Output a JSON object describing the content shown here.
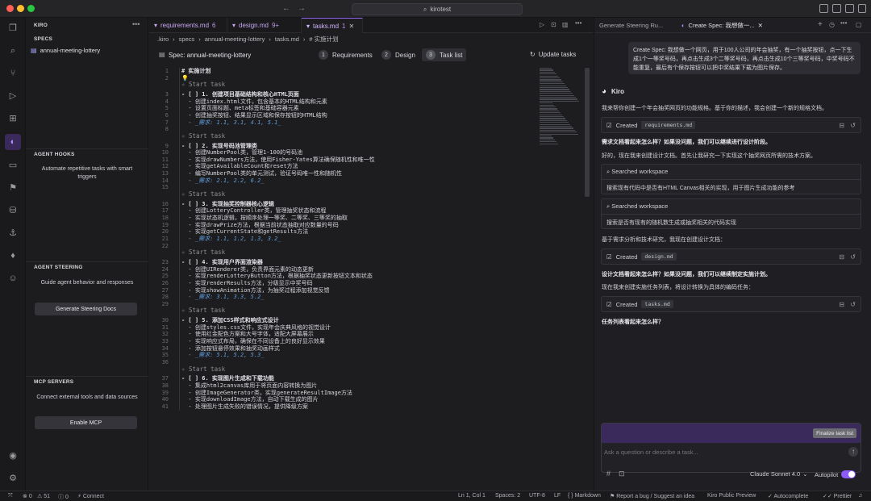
{
  "window": {
    "search_text": "kirotest"
  },
  "sidebar": {
    "title": "KIRO",
    "specs_header": "SPECS",
    "spec_item": "annual-meeting-lottery",
    "hooks_header": "AGENT HOOKS",
    "hooks_text": "Automate repetitive tasks with smart triggers",
    "steering_header": "AGENT STEERING",
    "steering_text": "Guide agent behavior and responses",
    "steering_button": "Generate Steering Docs",
    "mcp_header": "MCP SERVERS",
    "mcp_text": "Connect external tools and data sources",
    "mcp_button": "Enable MCP"
  },
  "editor": {
    "tabs": [
      {
        "label": "requirements.md",
        "count": "6"
      },
      {
        "label": "design.md",
        "count": "9+"
      },
      {
        "label": "tasks.md",
        "count": "1"
      }
    ],
    "breadcrumb": [
      ".kiro",
      "specs",
      "annual-meeting-lottery",
      "tasks.md",
      "# 实施计划"
    ],
    "spec_title": "Spec: annual-meeting-lottery",
    "steps": [
      {
        "n": "1",
        "label": "Requirements"
      },
      {
        "n": "2",
        "label": "Design"
      },
      {
        "n": "3",
        "label": "Task list"
      }
    ],
    "update_label": "Update tasks",
    "codelens": "Start task",
    "lines": [
      {
        "n": "1",
        "t": "# 实施计划"
      },
      {
        "n": "2",
        "t": ""
      },
      {
        "n": "3",
        "t": "- [ ] 1. 创建项目基础结构和核心HTML页面"
      },
      {
        "n": "4",
        "t": "  - 创建index.html文件，包含基本的HTML结构和元素"
      },
      {
        "n": "5",
        "t": "  - 设置页面标题、meta标签和基础容器元素"
      },
      {
        "n": "6",
        "t": "  - 创建抽奖按钮、结果显示区域和保存按钮的HTML结构"
      },
      {
        "n": "7",
        "t": "  - _需求: 1.1, 3.1, 4.1, 5.1_"
      },
      {
        "n": "8",
        "t": ""
      },
      {
        "n": "9",
        "t": "- [ ] 2. 实现号码池管理类"
      },
      {
        "n": "10",
        "t": "  - 创建NumberPool类，管理1-100的号码池"
      },
      {
        "n": "11",
        "t": "  - 实现drawNumbers方法，使用Fisher-Yates算法确保随机性和唯一性"
      },
      {
        "n": "12",
        "t": "  - 实现getAvailableCount和reset方法"
      },
      {
        "n": "13",
        "t": "  - 编写NumberPool类的单元测试，验证号码唯一性和随机性"
      },
      {
        "n": "14",
        "t": "  - _需求: 2.1, 2.2, 6.2_"
      },
      {
        "n": "15",
        "t": ""
      },
      {
        "n": "16",
        "t": "- [ ] 3. 实现抽奖控制器核心逻辑"
      },
      {
        "n": "17",
        "t": "  - 创建LotteryController类，管理抽奖状态和流程"
      },
      {
        "n": "18",
        "t": "  - 实现状态机逻辑，按顺序处理一等奖、二等奖、三等奖的抽取"
      },
      {
        "n": "19",
        "t": "  - 实现drawPrize方法，根据当前状态抽取对应数量的号码"
      },
      {
        "n": "20",
        "t": "  - 实现getCurrentState和getResults方法"
      },
      {
        "n": "21",
        "t": "  - _需求: 1.1, 1.2, 1.3, 3.2_"
      },
      {
        "n": "22",
        "t": ""
      },
      {
        "n": "23",
        "t": "- [ ] 4. 实现用户界面渲染器"
      },
      {
        "n": "24",
        "t": "  - 创建UIRenderer类，负责界面元素的动态更新"
      },
      {
        "n": "25",
        "t": "  - 实现renderLotteryButton方法，根据抽奖状态更新按钮文本和状态"
      },
      {
        "n": "26",
        "t": "  - 实现renderResults方法，分级显示中奖号码"
      },
      {
        "n": "27",
        "t": "  - 实现showAnimation方法，为抽奖过程添加视觉反馈"
      },
      {
        "n": "28",
        "t": "  - _需求: 3.1, 3.3, 5.2_"
      },
      {
        "n": "29",
        "t": ""
      },
      {
        "n": "30",
        "t": "- [ ] 5. 添加CSS样式和响应式设计"
      },
      {
        "n": "31",
        "t": "  - 创建styles.css文件，实现年会庆典风格的视觉设计"
      },
      {
        "n": "32",
        "t": "  - 使用红金配色方案和大号字体，适配大屏幕展示"
      },
      {
        "n": "33",
        "t": "  - 实现响应式布局，确保在不同设备上的良好显示效果"
      },
      {
        "n": "34",
        "t": "  - 添加按钮悬停效果和抽奖动画样式"
      },
      {
        "n": "35",
        "t": "  - _需求: 5.1, 5.2, 5.3_"
      },
      {
        "n": "36",
        "t": ""
      },
      {
        "n": "37",
        "t": "- [ ] 6. 实现图片生成和下载功能"
      },
      {
        "n": "38",
        "t": "  - 集成html2canvas库用于将页面内容转换为图片"
      },
      {
        "n": "39",
        "t": "  - 创建ImageGenerator类，实现generateResultImage方法"
      },
      {
        "n": "40",
        "t": "  - 实现downloadImage方法，自动下载生成的图片"
      },
      {
        "n": "41",
        "t": "  - 处理图片生成失败的错误情况，提供降级方案"
      }
    ]
  },
  "chat": {
    "tab1": "Generate Steering Ru...",
    "tab2": "Create Spec: 我想做一...",
    "user_msg": "Create Spec: 我想做一个网页，用于100人公司的年会抽奖，有一个抽奖按钮，点一下生成1个一等奖号码，再点击生成3个二等奖号码，再点击生成10个三等奖号码，中奖号码不能重复，最后有个保存按钮可以把中奖结果下载为图片保存。",
    "agent": "Kiro",
    "m1": "我来帮你创建一个年会抽奖网页的功能规格。基于你的描述，我会创建一个新的规格文档。",
    "created": "Created",
    "f1": "requirements.md",
    "m2": "需求文档看起来怎么样？如果没问题，我们可以继续进行设计阶段。",
    "m3": "好的，现在我来创建设计文档。首先让我研究一下实现这个抽奖网页所需的技术方案。",
    "searched": "Searched workspace",
    "s1": "搜索现有代码中是否有HTML Canvas相关的实现，用于图片生成功能的参考",
    "s2": "搜索是否有现有的随机数生成或抽奖相关的代码实现",
    "m4": "基于需求分析和技术研究，我现在创建设计文档：",
    "f2": "design.md",
    "m5": "设计文档看起来怎么样？如果没问题，我们可以继续制定实施计划。",
    "m6": "现在我来创建实施任务列表，将设计转换为具体的编码任务：",
    "f3": "tasks.md",
    "m7": "任务列表看起来怎么样？",
    "finalize": "Finalize task list",
    "placeholder": "Ask a question or describe a task...",
    "model": "Claude Sonnet 4.0",
    "autopilot": "Autopilot"
  },
  "status": {
    "errors": "0",
    "warnings": "51",
    "info": "0",
    "connect": "Connect",
    "position": "Ln 1, Col 1",
    "spaces": "Spaces: 2",
    "encoding": "UTF-8",
    "eol": "LF",
    "lang": "Markdown",
    "report": "Report a bug / Suggest an idea",
    "preview": "Kiro Public Preview",
    "autocomplete": "Autocomplete",
    "prettier": "Prettier"
  }
}
